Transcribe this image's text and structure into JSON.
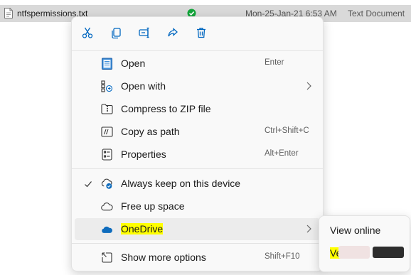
{
  "file": {
    "name": "ntfspermissions.txt",
    "date": "Mon-25-Jan-21 6:53 AM",
    "type": "Text Document",
    "icons": {
      "file": "text-file-icon",
      "sync": "synced-check-icon"
    }
  },
  "quick_actions": [
    {
      "name": "cut-icon"
    },
    {
      "name": "copy-icon"
    },
    {
      "name": "rename-icon"
    },
    {
      "name": "share-icon"
    },
    {
      "name": "delete-icon"
    }
  ],
  "menu": {
    "items": [
      {
        "label": "Open",
        "shortcut": "Enter",
        "icon": "notepad-icon"
      },
      {
        "label": "Open with",
        "icon": "open-with-icon",
        "has_submenu": true
      },
      {
        "label": "Compress to ZIP file",
        "icon": "zip-folder-icon"
      },
      {
        "label": "Copy as path",
        "shortcut": "Ctrl+Shift+C",
        "icon": "copy-path-icon"
      },
      {
        "label": "Properties",
        "shortcut": "Alt+Enter",
        "icon": "properties-icon"
      },
      {
        "label": "Always keep on this device",
        "icon": "cloud-pin-icon",
        "checked": true
      },
      {
        "label": "Free up space",
        "icon": "cloud-outline-icon"
      },
      {
        "label": "OneDrive",
        "icon": "onedrive-icon",
        "has_submenu": true,
        "highlighted": true
      },
      {
        "label": "Show more options",
        "shortcut": "Shift+F10",
        "icon": "more-options-icon"
      }
    ]
  },
  "submenu": {
    "items": [
      {
        "label": "View online"
      },
      {
        "label": "Ve"
      }
    ]
  },
  "colors": {
    "accent": "#0067c0",
    "highlight": "#ffff00",
    "onedrive": "#0f6cbd",
    "sync_green": "#12a53a"
  }
}
